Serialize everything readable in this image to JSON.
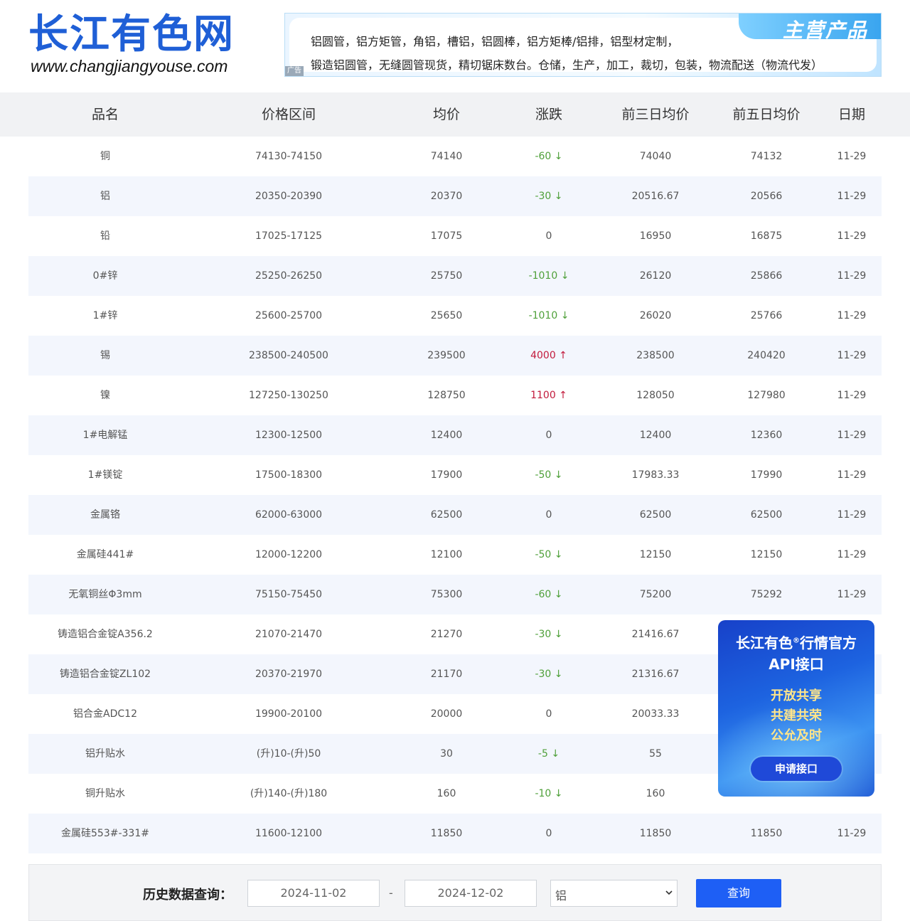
{
  "header": {
    "logo_cn": "长江有色网",
    "logo_en": "www.changjiangyouse.com",
    "ad": {
      "tab": "主营产品",
      "line1": "铝圆管，铝方矩管，角铝，槽铝，铝圆棒，铝方矩棒/铝排，铝型材定制，",
      "line2": "锻造铝圆管，无缝圆管现货，精切锯床数台。仓储，生产，加工，裁切，包装，物流配送（物流代发）",
      "tag": "广告"
    }
  },
  "table": {
    "headers": [
      "品名",
      "价格区间",
      "均价",
      "涨跌",
      "前三日均价",
      "前五日均价",
      "日期"
    ],
    "rows": [
      {
        "name": "铜",
        "range": "74130-74150",
        "avg": "74140",
        "change": "-60 ↓",
        "trend": "down",
        "avg3": "74040",
        "avg5": "74132",
        "date": "11-29"
      },
      {
        "name": "铝",
        "range": "20350-20390",
        "avg": "20370",
        "change": "-30 ↓",
        "trend": "down",
        "avg3": "20516.67",
        "avg5": "20566",
        "date": "11-29"
      },
      {
        "name": "铅",
        "range": "17025-17125",
        "avg": "17075",
        "change": "0",
        "trend": "flat",
        "avg3": "16950",
        "avg5": "16875",
        "date": "11-29"
      },
      {
        "name": "0#锌",
        "range": "25250-26250",
        "avg": "25750",
        "change": "-1010 ↓",
        "trend": "down",
        "avg3": "26120",
        "avg5": "25866",
        "date": "11-29"
      },
      {
        "name": "1#锌",
        "range": "25600-25700",
        "avg": "25650",
        "change": "-1010 ↓",
        "trend": "down",
        "avg3": "26020",
        "avg5": "25766",
        "date": "11-29"
      },
      {
        "name": "锡",
        "range": "238500-240500",
        "avg": "239500",
        "change": "4000 ↑",
        "trend": "up",
        "avg3": "238500",
        "avg5": "240420",
        "date": "11-29"
      },
      {
        "name": "镍",
        "range": "127250-130250",
        "avg": "128750",
        "change": "1100 ↑",
        "trend": "up",
        "avg3": "128050",
        "avg5": "127980",
        "date": "11-29"
      },
      {
        "name": "1#电解锰",
        "range": "12300-12500",
        "avg": "12400",
        "change": "0",
        "trend": "flat",
        "avg3": "12400",
        "avg5": "12360",
        "date": "11-29"
      },
      {
        "name": "1#镁锭",
        "range": "17500-18300",
        "avg": "17900",
        "change": "-50 ↓",
        "trend": "down",
        "avg3": "17983.33",
        "avg5": "17990",
        "date": "11-29"
      },
      {
        "name": "金属铬",
        "range": "62000-63000",
        "avg": "62500",
        "change": "0",
        "trend": "flat",
        "avg3": "62500",
        "avg5": "62500",
        "date": "11-29"
      },
      {
        "name": "金属硅441#",
        "range": "12000-12200",
        "avg": "12100",
        "change": "-50 ↓",
        "trend": "down",
        "avg3": "12150",
        "avg5": "12150",
        "date": "11-29"
      },
      {
        "name": "无氧铜丝Φ3mm",
        "range": "75150-75450",
        "avg": "75300",
        "change": "-60 ↓",
        "trend": "down",
        "avg3": "75200",
        "avg5": "75292",
        "date": "11-29"
      },
      {
        "name": "铸造铝合金锭A356.2",
        "range": "21070-21470",
        "avg": "21270",
        "change": "-30 ↓",
        "trend": "down",
        "avg3": "21416.67",
        "avg5": "",
        "date": ""
      },
      {
        "name": "铸造铝合金锭ZL102",
        "range": "20370-21970",
        "avg": "21170",
        "change": "-30 ↓",
        "trend": "down",
        "avg3": "21316.67",
        "avg5": "",
        "date": ""
      },
      {
        "name": "铝合金ADC12",
        "range": "19900-20100",
        "avg": "20000",
        "change": "0",
        "trend": "flat",
        "avg3": "20033.33",
        "avg5": "",
        "date": ""
      },
      {
        "name": "铝升贴水",
        "range": "(升)10-(升)50",
        "avg": "30",
        "change": "-5 ↓",
        "trend": "down",
        "avg3": "55",
        "avg5": "",
        "date": ""
      },
      {
        "name": "铜升贴水",
        "range": "(升)140-(升)180",
        "avg": "160",
        "change": "-10 ↓",
        "trend": "down",
        "avg3": "160",
        "avg5": "",
        "date": ""
      },
      {
        "name": "金属硅553#-331#",
        "range": "11600-12100",
        "avg": "11850",
        "change": "0",
        "trend": "flat",
        "avg3": "11850",
        "avg5": "11850",
        "date": "11-29"
      }
    ]
  },
  "query": {
    "label": "历史数据查询：",
    "start_date": "2024-11-02",
    "separator": "-",
    "end_date": "2024-12-02",
    "metal_selected": "铝",
    "button": "查询"
  },
  "api_ad": {
    "title1": "长江有色",
    "reg": "®",
    "title1b": "行情官方",
    "title2": "API接口",
    "tags": [
      "开放共享",
      "共建共荣",
      "公允及时"
    ],
    "button": "申请接口"
  },
  "colors": {
    "brand_blue": "#1f5fd6",
    "down_green": "#4fa03a",
    "up_red": "#c21a3c",
    "button_blue": "#1e5ff5"
  }
}
